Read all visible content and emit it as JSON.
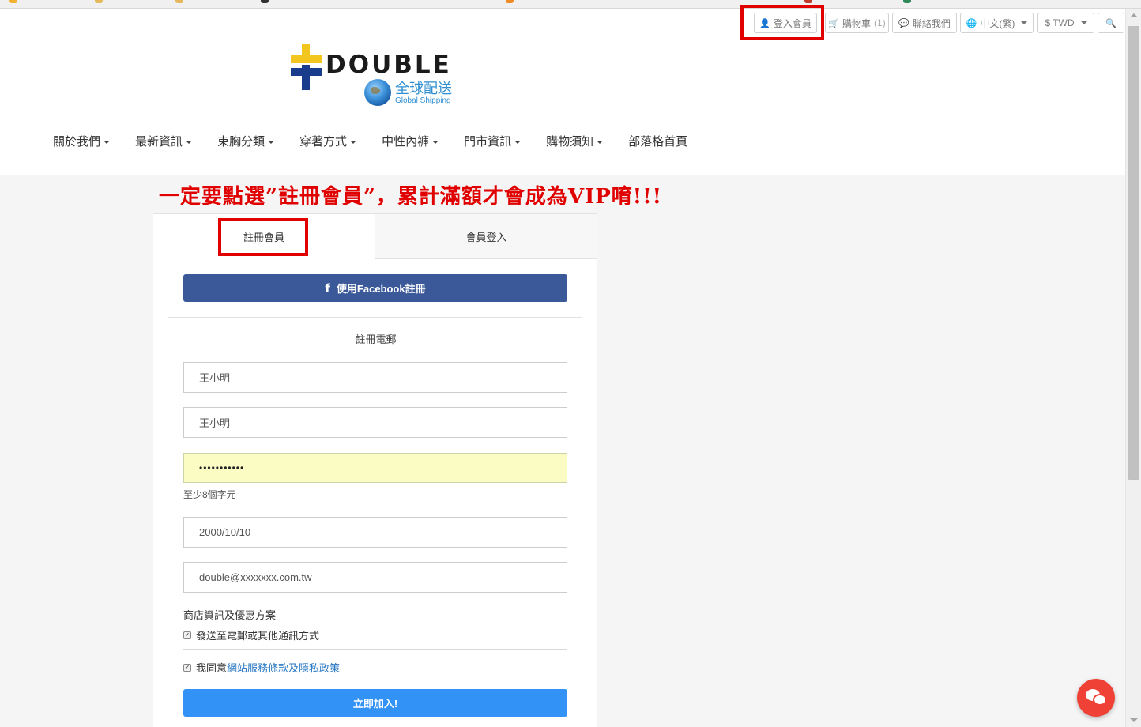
{
  "topbar": {
    "login": "登入會員",
    "cart": "購物車",
    "cart_count": "(1)",
    "contact": "聯絡我們",
    "language": "中文(繁)",
    "currency": "$ TWD"
  },
  "logo": {
    "wordmark": "DOUBLE",
    "tagline_zh": "全球配送",
    "tagline_en": "Global Shipping"
  },
  "nav": [
    {
      "label": "關於我們"
    },
    {
      "label": "最新資訊"
    },
    {
      "label": "束胸分類"
    },
    {
      "label": "穿著方式"
    },
    {
      "label": "中性內褲"
    },
    {
      "label": "門市資訊"
    },
    {
      "label": "購物須知"
    },
    {
      "label": "部落格首頁"
    }
  ],
  "notice": "一定要點選”註冊會員”，累計滿額才會成為VIP唷!!!",
  "tabs": {
    "register": "註冊會員",
    "login": "會員登入"
  },
  "form": {
    "facebook_label": "使用Facebook註冊",
    "section_title": "註冊電郵",
    "name": "王小明",
    "name2": "王小明",
    "password": "•••••••••••",
    "password_hint": "至少8個字元",
    "birthday": "2000/10/10",
    "email": "double@xxxxxxx.com.tw",
    "promo_label": "商店資訊及優惠方案",
    "promo_check": "發送至電郵或其他通訊方式",
    "agree_prefix": "我同意",
    "agree_link": "網站服務條款及隱私政策",
    "submit": "立即加入!"
  },
  "colors": {
    "highlight": "#e00000",
    "facebook": "#3b5998",
    "submit": "#3392f6",
    "chat": "#ef4136"
  }
}
